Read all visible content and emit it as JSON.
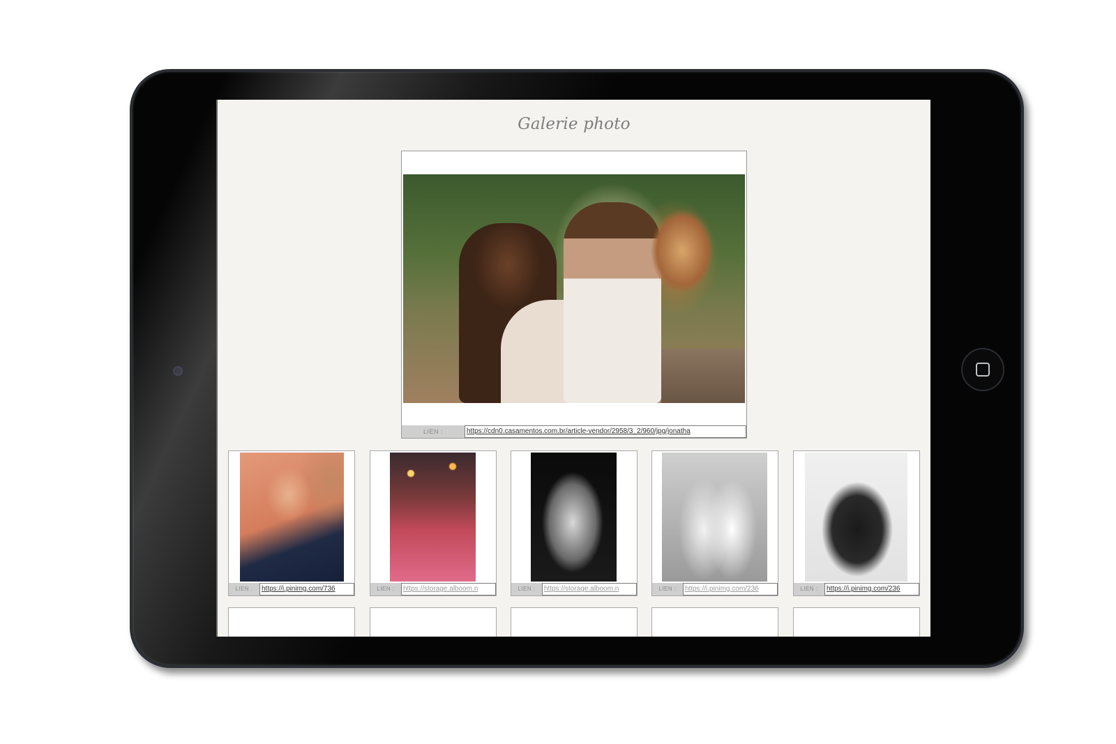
{
  "page": {
    "title": "Galerie photo"
  },
  "main_image": {
    "link_label": "LIEN :",
    "link_value": "https://cdn0.casamentos.com.br/article-vendor/2958/3_2/960/jpg/jonatha"
  },
  "thumbnails": [
    {
      "link_label": "LIEN :",
      "link_value": "https://i.pinimg.com/736"
    },
    {
      "link_label": "LIEN :",
      "link_value": "https://storage.alboom.n"
    },
    {
      "link_label": "LIEN :",
      "link_value": "https://storage.alboom.n"
    },
    {
      "link_label": "LIEN :",
      "link_value": "https://i.pinimg.com/236"
    },
    {
      "link_label": "LIEN :",
      "link_value": "https://i.pinimg.com/236"
    }
  ]
}
